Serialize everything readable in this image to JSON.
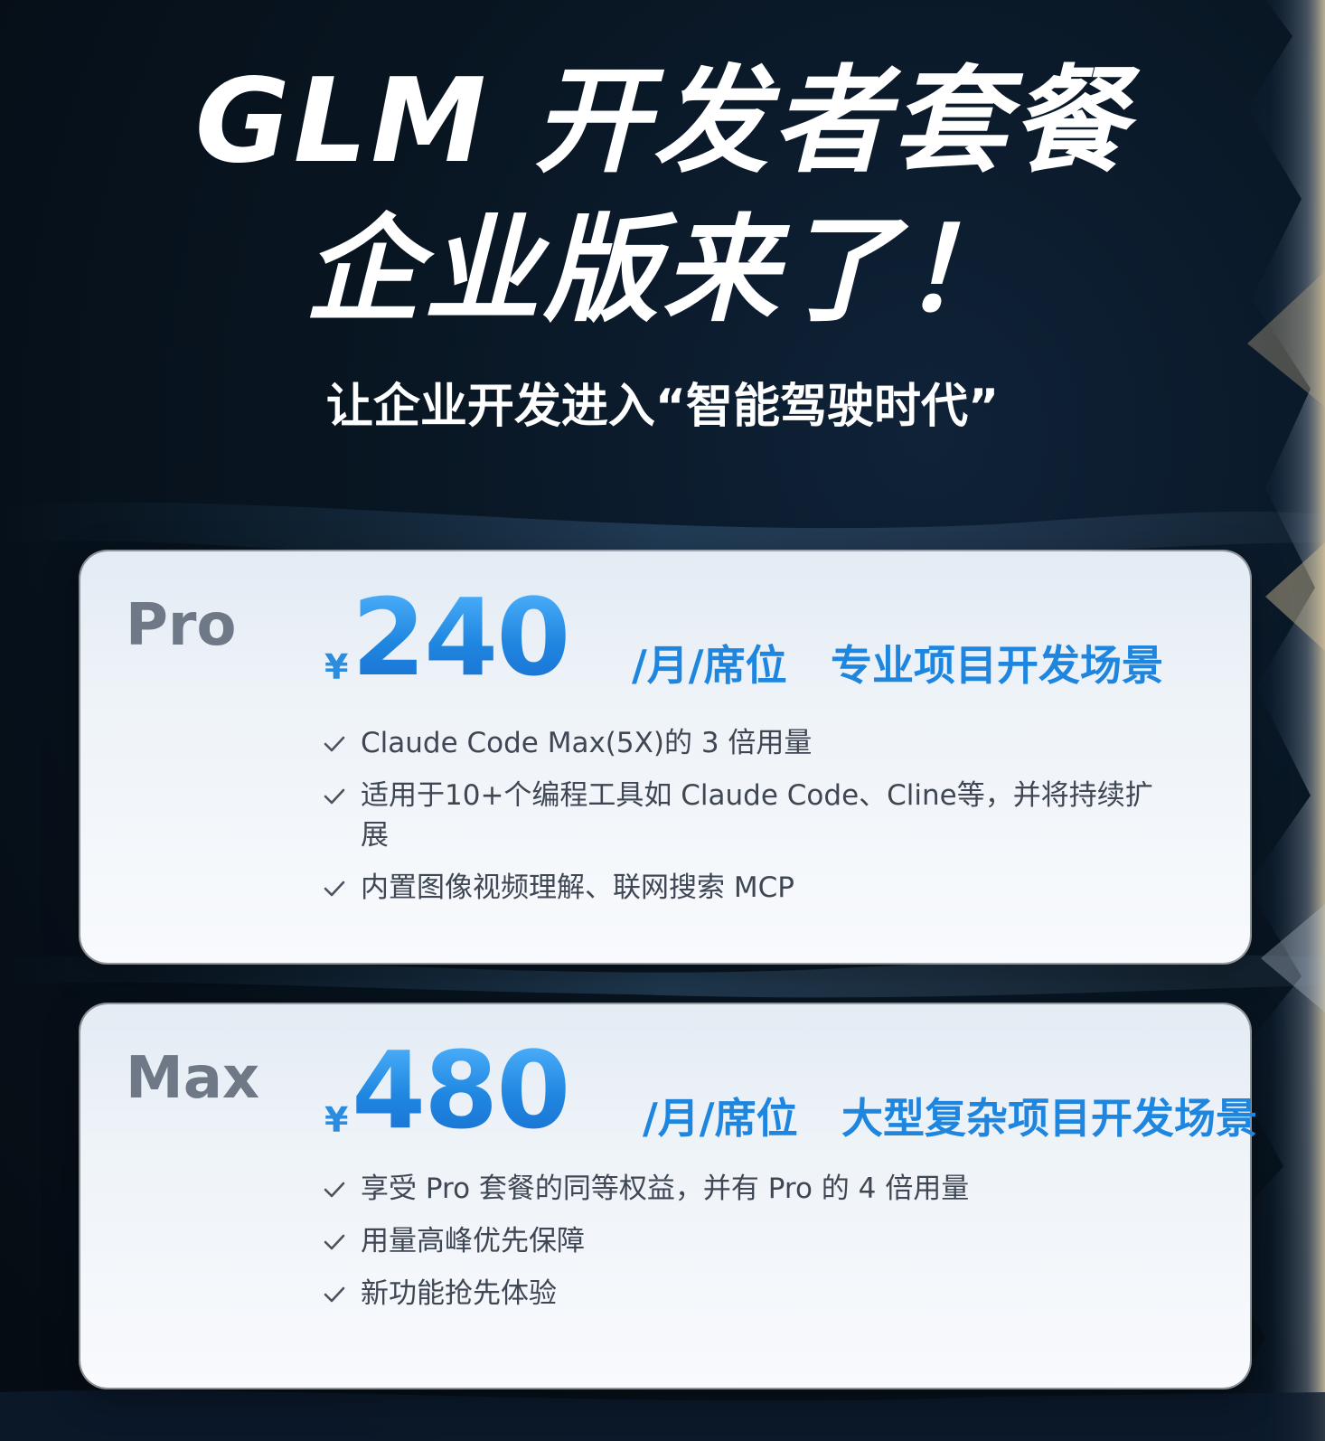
{
  "header": {
    "title_line1": "GLM 开发者套餐",
    "title_line2": "企业版来了！",
    "subtitle": "让企业开发进入“智能驾驶时代”"
  },
  "plans": [
    {
      "name": "Pro",
      "currency": "¥",
      "price": "240",
      "unit": "/月/席位",
      "scene": "专业项目开发场景",
      "features": [
        "Claude Code Max(5X)的 3 倍用量",
        "适用于10+个编程工具如 Claude Code、Cline等，并将持续扩展",
        "内置图像视频理解、联网搜索 MCP"
      ]
    },
    {
      "name": "Max",
      "currency": "¥",
      "price": "480",
      "unit": "/月/席位",
      "scene": "大型复杂项目开发场景",
      "features": [
        "享受 Pro 套餐的同等权益，并有 Pro 的 4 倍用量",
        "用量高峰优先保障",
        "新功能抢先体验"
      ]
    }
  ],
  "icons": {
    "feature_check": "check-icon"
  },
  "colors": {
    "background": "#081521",
    "price_blue": "#1f86e0",
    "plan_name_gray": "#6e7886",
    "feature_text": "#3e4753"
  }
}
